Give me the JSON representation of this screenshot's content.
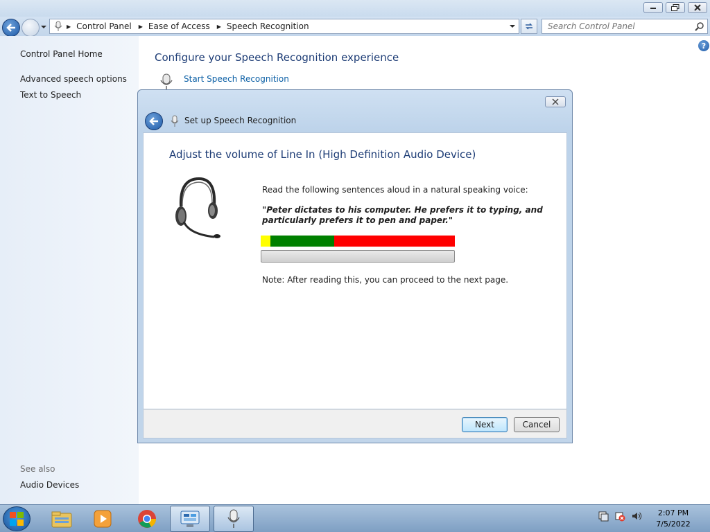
{
  "window": {
    "address_crumbs": [
      "Control Panel",
      "Ease of Access",
      "Speech Recognition"
    ],
    "search_placeholder": "Search Control Panel"
  },
  "sidebar": {
    "home": "Control Panel Home",
    "items": [
      "Advanced speech options",
      "Text to Speech"
    ],
    "see_also_label": "See also",
    "see_also_items": [
      "Audio Devices"
    ]
  },
  "main": {
    "title": "Configure your Speech Recognition experience",
    "start_link": "Start Speech Recognition"
  },
  "dialog": {
    "title": "Set up Speech Recognition",
    "heading": "Adjust the volume of Line In (High Definition Audio Device)",
    "instruction": "Read the following sentences aloud in a natural speaking voice:",
    "quote": "\"Peter dictates to his computer. He prefers it to typing, and particularly prefers it to pen and paper.\"",
    "meter": {
      "segments": [
        {
          "color": "#ffff00",
          "fraction": 0.05
        },
        {
          "color": "#008000",
          "fraction": 0.33
        },
        {
          "color": "#ff0000",
          "fraction": 0.62
        }
      ]
    },
    "progress_fraction": 0,
    "note": "Note: After reading this, you can proceed to the next page.",
    "next_label": "Next",
    "cancel_label": "Cancel"
  },
  "taskbar": {
    "items": [
      "windows-explorer-icon",
      "media-player-icon",
      "chrome-icon",
      "control-panel-icon",
      "speech-recognition-icon"
    ],
    "time": "2:07 PM",
    "date": "7/5/2022"
  }
}
